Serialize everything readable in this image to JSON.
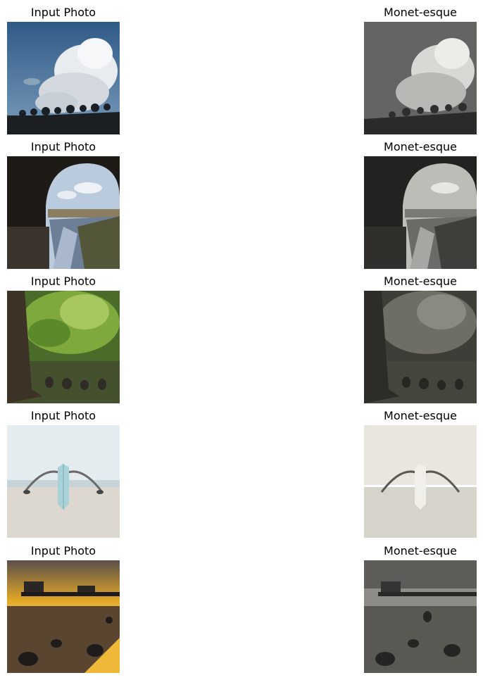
{
  "rows": [
    {
      "input_title": "Input Photo",
      "output_title": "Monet-esque",
      "scene": "cloud-field"
    },
    {
      "input_title": "Input Photo",
      "output_title": "Monet-esque",
      "scene": "bridge-river"
    },
    {
      "input_title": "Input Photo",
      "output_title": "Monet-esque",
      "scene": "forest"
    },
    {
      "input_title": "Input Photo",
      "output_title": "Monet-esque",
      "scene": "beach-boat"
    },
    {
      "input_title": "Input Photo",
      "output_title": "Monet-esque",
      "scene": "pier-sunset"
    }
  ]
}
